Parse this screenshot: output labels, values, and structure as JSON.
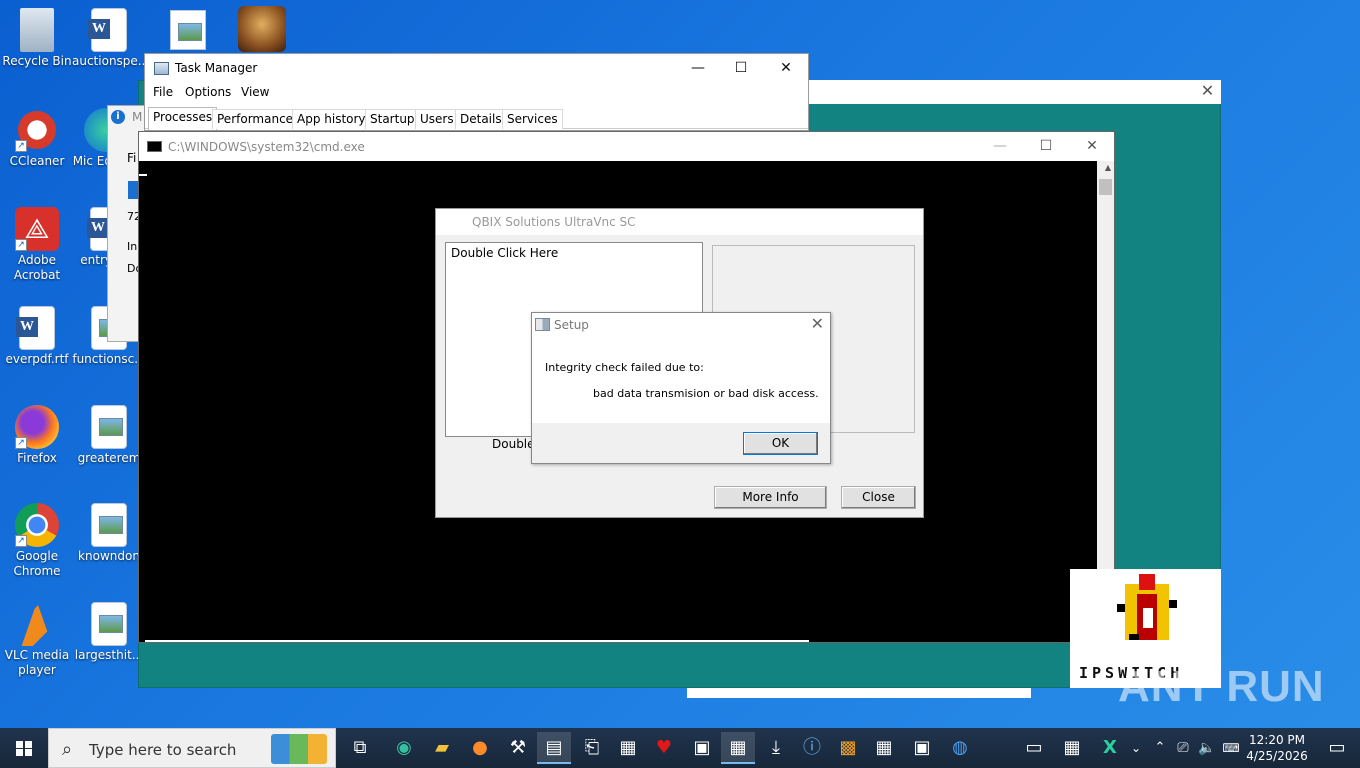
{
  "desktop": {
    "icons": [
      {
        "label": "Recycle Bin",
        "icon": "recycle-bin-icon"
      },
      {
        "label": "auctionspe...",
        "icon": "word-doc-icon"
      },
      {
        "label": "CCleaner",
        "icon": "ccleaner-icon"
      },
      {
        "label": "Mic Ed",
        "icon": "edge-icon"
      },
      {
        "label": "Adobe Acrobat",
        "icon": "acrobat-icon"
      },
      {
        "label": "entry",
        "icon": "word-doc-icon"
      },
      {
        "label": "everpdf.rtf",
        "icon": "word-doc-icon"
      },
      {
        "label": "functionsc...",
        "icon": "file-icon"
      },
      {
        "label": "Firefox",
        "icon": "firefox-icon"
      },
      {
        "label": "greaterem",
        "icon": "image-file-icon"
      },
      {
        "label": "Google Chrome",
        "icon": "chrome-icon"
      },
      {
        "label": "knowndon",
        "icon": "image-file-icon"
      },
      {
        "label": "VLC media player",
        "icon": "vlc-icon"
      },
      {
        "label": "largesthit...",
        "icon": "image-file-icon"
      }
    ]
  },
  "task_manager": {
    "title": "Task Manager",
    "menu": [
      "File",
      "Options",
      "View"
    ],
    "tabs": [
      "Processes",
      "Performance",
      "App history",
      "Startup",
      "Users",
      "Details",
      "Services"
    ],
    "active_tab": "Processes"
  },
  "hidden_window": {
    "title_fragment": "M",
    "lines": [
      "Fi",
      "72",
      "In",
      "Do"
    ]
  },
  "cmd": {
    "title": "C:\\WINDOWS\\system32\\cmd.exe"
  },
  "qbix": {
    "title": "QBIX Solutions UltraVnc SC",
    "list_item": "Double Click Here",
    "hint": "Double C",
    "more_info": "More Info",
    "close": "Close"
  },
  "setup": {
    "title": "Setup",
    "line1": "Integrity check failed due to:",
    "line2": "bad data transmision or bad disk access.",
    "ok": "OK"
  },
  "ipswitch": {
    "brand": "IPSWITCH"
  },
  "watermark": "ANY RUN",
  "taskbar": {
    "search_placeholder": "Type here to search",
    "time": "12:20 PM",
    "date": "4/25/2026",
    "apps": [
      "task-view-icon",
      "edge-icon",
      "file-explorer-icon",
      "firefox-icon",
      "tool-icon",
      "task-manager-icon",
      "app-icon",
      "network-icon",
      "heart-icon",
      "window-icon",
      "network-icon",
      "download-icon",
      "info-icon",
      "image-icon",
      "network-icon",
      "window-icon",
      "circle-app-icon",
      "cmd-icon",
      "network-icon",
      "x-app-icon"
    ]
  }
}
